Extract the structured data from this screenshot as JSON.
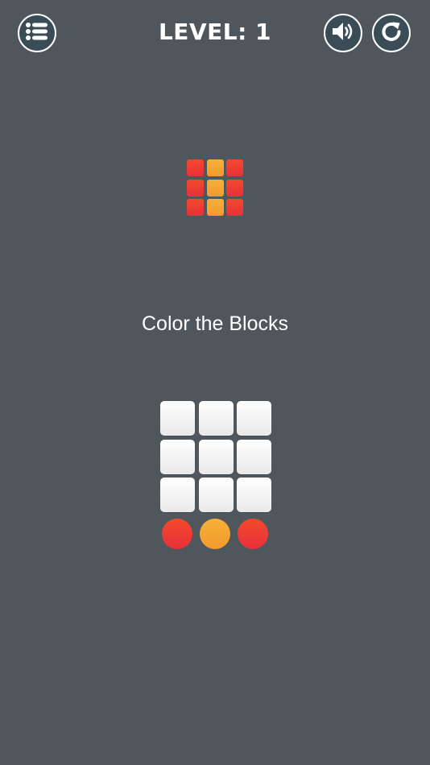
{
  "header": {
    "level_text": "LEVEL: 1",
    "menu_icon": "list-menu-icon",
    "sound_icon": "speaker-volume-icon",
    "restart_icon": "restart-icon"
  },
  "colors": {
    "background": "#4f565c",
    "button_fill": "#3a4d57",
    "red_top": "#f24a2c",
    "red_bottom": "#e8303a",
    "orange_top": "#f6b13a",
    "orange_bottom": "#f39a2c",
    "tile_white": "#ffffff"
  },
  "target_pattern": {
    "rows": [
      [
        "red",
        "orange",
        "red"
      ],
      [
        "red",
        "orange",
        "red"
      ],
      [
        "red",
        "orange",
        "red"
      ]
    ]
  },
  "instruction": "Color the Blocks",
  "board": {
    "rows": [
      [
        "empty",
        "empty",
        "empty"
      ],
      [
        "empty",
        "empty",
        "empty"
      ],
      [
        "empty",
        "empty",
        "empty"
      ]
    ]
  },
  "palette": [
    "red",
    "orange",
    "red"
  ]
}
